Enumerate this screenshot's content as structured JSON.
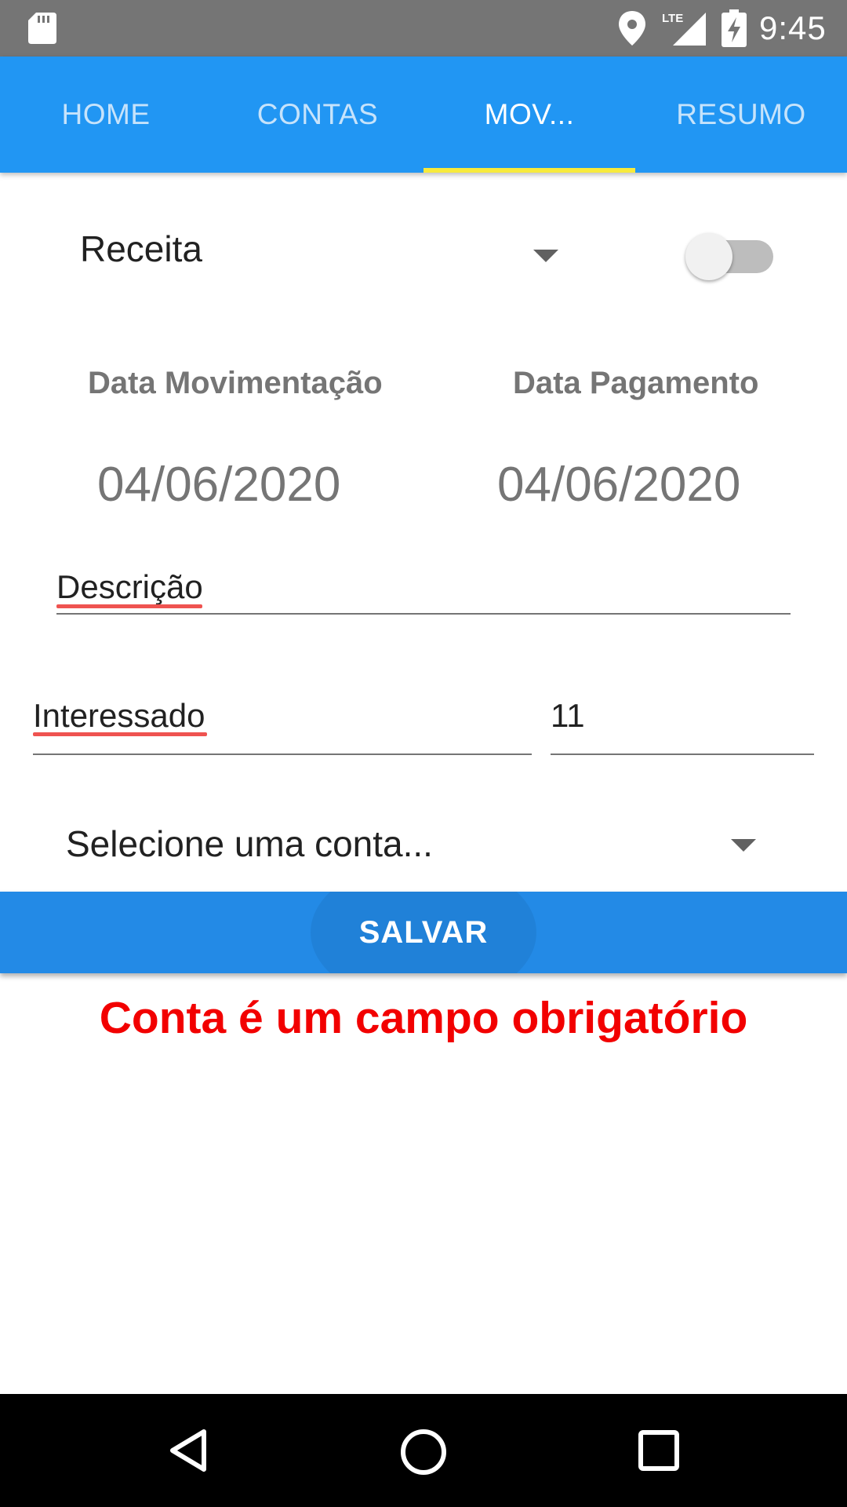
{
  "status_bar": {
    "time": "9:45",
    "network_label": "LTE",
    "icons": [
      "sd-card-icon",
      "location-icon",
      "signal-icon",
      "battery-charging-icon"
    ]
  },
  "tabs": [
    {
      "label": "HOME",
      "active": false
    },
    {
      "label": "CONTAS",
      "active": false
    },
    {
      "label": "MOV...",
      "active": true
    },
    {
      "label": "RESUMO",
      "active": false
    }
  ],
  "colors": {
    "status_bar": "#757575",
    "tab_bar": "#2196F3",
    "tab_indicator": "#f7ea3c",
    "save_button": "#238AE6",
    "error": "#f20000"
  },
  "form": {
    "type_selected": "Receita",
    "toggle_on": false,
    "date_movimentacao_label": "Data Movimentação",
    "date_pagamento_label": "Data Pagamento",
    "date_movimentacao_value": "04/06/2020",
    "date_pagamento_value": "04/06/2020",
    "descricao_value": "Descrição",
    "interessado_value": "Interessado",
    "number_value": "11",
    "account_selected": "Selecione uma conta..."
  },
  "actions": {
    "save_label": "SALVAR"
  },
  "error_message": "Conta é um campo obrigatório",
  "nav_bar": {
    "icons": [
      "back-icon",
      "home-icon",
      "recents-icon"
    ]
  }
}
